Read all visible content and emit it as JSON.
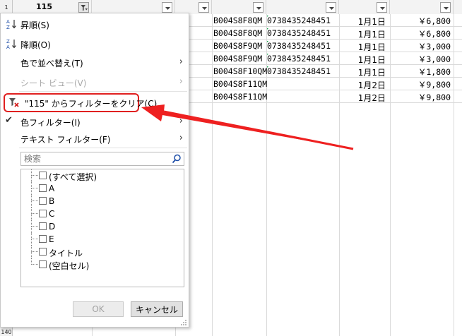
{
  "header": {
    "filter_col_label": "115",
    "row1": "1",
    "row_bottom": "140"
  },
  "rows": [
    {
      "code": "B004S8F8QM",
      "jan": "0738435248451",
      "date": "1月1日",
      "price": "￥6,800"
    },
    {
      "code": "B004S8F8QM",
      "jan": "0738435248451",
      "date": "1月1日",
      "price": "￥6,800"
    },
    {
      "code": "B004S8F9QM",
      "jan": "0738435248451",
      "date": "1月1日",
      "price": "￥3,000"
    },
    {
      "code": "B004S8F9QM",
      "jan": "0738435248451",
      "date": "1月1日",
      "price": "￥3,000"
    },
    {
      "code": "B004S8F10QM",
      "jan": "0738435248451",
      "date": "1月1日",
      "price": "￥1,800"
    },
    {
      "code": "B004S8F11QM",
      "jan": "",
      "date": "1月2日",
      "price": "￥9,800"
    },
    {
      "code": "B004S8F11QM",
      "jan": "",
      "date": "1月2日",
      "price": "￥9,800"
    }
  ],
  "menu": {
    "sort_asc": "昇順(S)",
    "sort_desc": "降順(O)",
    "sort_by_color": "色で並べ替え(T)",
    "sheet_view": "シート ビュー(V)",
    "clear_filter": "\"115\" からフィルターをクリア(C)",
    "color_filter": "色フィルター(I)",
    "text_filter": "テキスト フィルター(F)",
    "chevron": "›",
    "check": "✔"
  },
  "search": {
    "placeholder": "検索"
  },
  "list": [
    {
      "label": "(すべて選択)"
    },
    {
      "label": "A"
    },
    {
      "label": "B"
    },
    {
      "label": "C"
    },
    {
      "label": "D"
    },
    {
      "label": "E"
    },
    {
      "label": "タイトル"
    },
    {
      "label": "(空白セル)"
    }
  ],
  "buttons": {
    "ok": "OK",
    "cancel": "キャンセル"
  },
  "colors": {
    "accent_red": "#e02020",
    "check_green": "#17a34a"
  }
}
